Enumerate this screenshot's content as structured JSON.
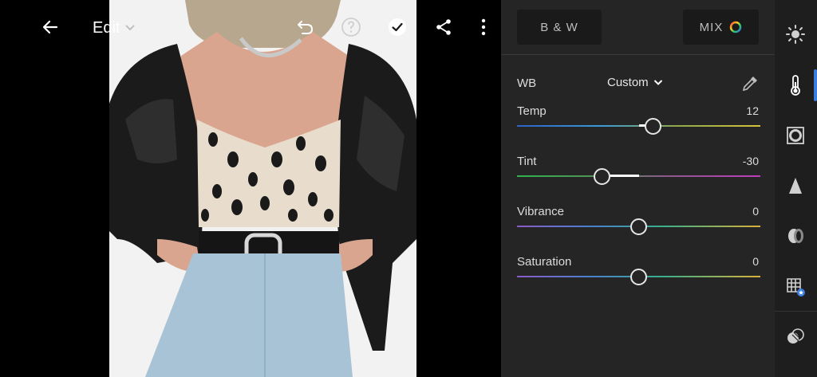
{
  "toolbar": {
    "back_icon": "arrow-left-icon",
    "edit_label": "Edit",
    "icons": [
      "undo-icon",
      "help-icon",
      "checkmark-icon",
      "share-icon",
      "more-vertical-icon"
    ]
  },
  "panel": {
    "bw_label": "B & W",
    "mix_label": "MIX",
    "wb": {
      "label": "WB",
      "value": "Custom"
    },
    "sliders": [
      {
        "label": "Temp",
        "value": "12",
        "position": 0.56,
        "fill_from": 0.5
      },
      {
        "label": "Tint",
        "value": "-30",
        "position": 0.35,
        "fill_from": 0.5
      },
      {
        "label": "Vibrance",
        "value": "0",
        "position": 0.5,
        "fill_from": 0.5
      },
      {
        "label": "Saturation",
        "value": "0",
        "position": 0.5,
        "fill_from": 0.5
      }
    ]
  },
  "rail": {
    "icons": [
      "light-icon",
      "color-icon",
      "effects-icon",
      "detail-icon",
      "optics-icon",
      "geometry-icon",
      "mask-icon"
    ],
    "active": "color-icon"
  },
  "colors": {
    "accent": "#3b7de0",
    "panel_bg": "#252525",
    "rail_bg": "#1e1e1e"
  }
}
